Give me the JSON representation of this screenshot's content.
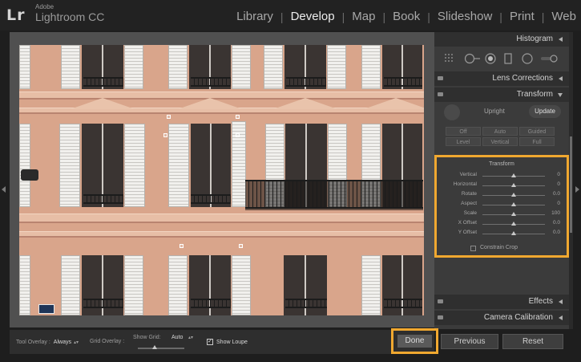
{
  "app": {
    "logo": "Lr",
    "brand_small": "Adobe",
    "brand_main": "Lightroom CC"
  },
  "modules": [
    {
      "label": "Library",
      "active": false
    },
    {
      "label": "Develop",
      "active": true
    },
    {
      "label": "Map",
      "active": false
    },
    {
      "label": "Book",
      "active": false
    },
    {
      "label": "Slideshow",
      "active": false
    },
    {
      "label": "Print",
      "active": false
    },
    {
      "label": "Web",
      "active": false
    }
  ],
  "module_separator": "|",
  "panels": {
    "histogram": "Histogram",
    "lens_corrections": "Lens Corrections",
    "transform": "Transform",
    "effects": "Effects",
    "camera_calibration": "Camera Calibration"
  },
  "upright": {
    "label": "Upright",
    "update_label": "Update",
    "buttons": [
      "Off",
      "Auto",
      "Guided",
      "Level",
      "Vertical",
      "Full"
    ]
  },
  "transform": {
    "title": "Transform",
    "sliders": [
      {
        "label": "Vertical",
        "value": "0",
        "level": 0.5
      },
      {
        "label": "Horizontal",
        "value": "0",
        "level": 0.5
      },
      {
        "label": "Rotate",
        "value": "0.0",
        "level": 0.5
      },
      {
        "label": "Aspect",
        "value": "0",
        "level": 0.5
      },
      {
        "label": "Scale",
        "value": "100",
        "level": 0.5
      },
      {
        "label": "X Offset",
        "value": "0.0",
        "level": 0.5
      },
      {
        "label": "Y Offset",
        "value": "0.0",
        "level": 0.5
      }
    ],
    "constrain_crop": "Constrain Crop",
    "constrain_checked": false
  },
  "toolbar": {
    "tool_overlay_label": "Tool Overlay :",
    "tool_overlay_value": "Always",
    "grid_overlay_label": "Grid Overlay :",
    "show_grid_label": "Show Grid:",
    "show_grid_value": "Auto",
    "show_loupe_label": "Show Loupe",
    "show_loupe_checked": true
  },
  "buttons": {
    "done": "Done",
    "previous": "Previous",
    "reset": "Reset"
  },
  "colors": {
    "highlight": "#f0a830",
    "facade": "#d9a58b"
  }
}
